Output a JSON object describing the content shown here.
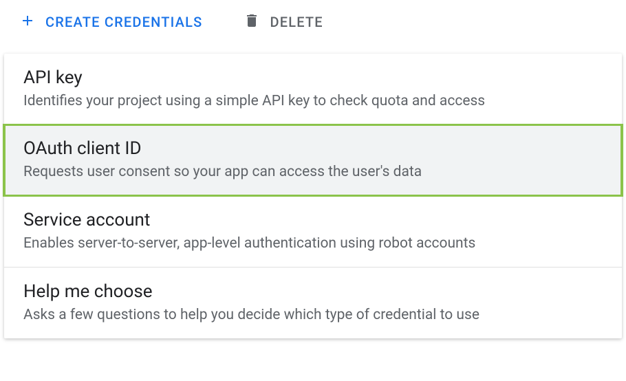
{
  "toolbar": {
    "create_label": "CREATE CREDENTIALS",
    "delete_label": "DELETE"
  },
  "menu": {
    "items": [
      {
        "title": "API key",
        "desc": "Identifies your project using a simple API key to check quota and access",
        "highlighted": false
      },
      {
        "title": "OAuth client ID",
        "desc": "Requests user consent so your app can access the user's data",
        "highlighted": true
      },
      {
        "title": "Service account",
        "desc": "Enables server-to-server, app-level authentication using robot accounts",
        "highlighted": false
      },
      {
        "title": "Help me choose",
        "desc": "Asks a few questions to help you decide which type of credential to use",
        "highlighted": false
      }
    ]
  }
}
